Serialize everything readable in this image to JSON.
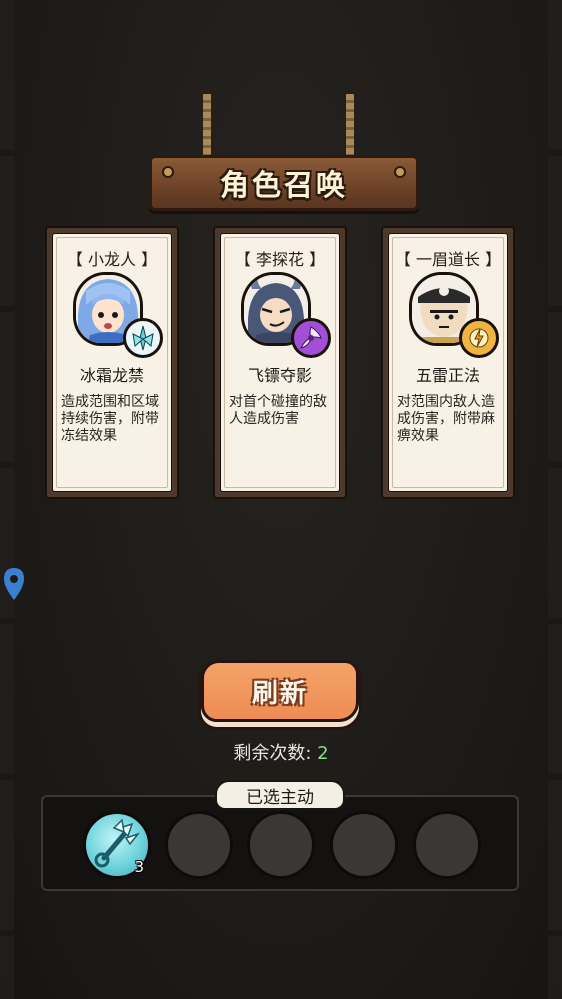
{
  "screen_title": "角色召唤",
  "cards": [
    {
      "character": "【 小龙人 】",
      "skill": "冰霜龙禁",
      "description": "造成范围和区域持续伤害，附带冻结效果",
      "portrait_icon": "blue-hair-hero-portrait",
      "badge_icon": "ice-crystal-icon",
      "badge_color": "#7fe3ea"
    },
    {
      "character": "【 李探花 】",
      "skill": "飞镖夺影",
      "description": "对首个碰撞的敌人造成伤害",
      "portrait_icon": "horned-helmet-hero-portrait",
      "badge_icon": "purple-shuriken-icon",
      "badge_color": "#a04fd6"
    },
    {
      "character": "【 一眉道长 】",
      "skill": "五雷正法",
      "description": "对范围内敌人造成伤害，附带麻痹效果",
      "portrait_icon": "taoist-priest-portrait",
      "badge_icon": "lightning-orb-icon",
      "badge_color": "#f2b440"
    }
  ],
  "refresh_button": "刷新",
  "remaining": {
    "label": "剩余次数:",
    "count": "2"
  },
  "selected_panel": {
    "title": "已选主动",
    "slots": [
      {
        "icon": "ice-trident-skill-icon",
        "level": "3"
      },
      {
        "icon": "empty-slot"
      },
      {
        "icon": "empty-slot"
      },
      {
        "icon": "empty-slot"
      },
      {
        "icon": "empty-slot"
      }
    ]
  },
  "colors": {
    "background": "#1e1c1a",
    "sign_wood": "#7a4a2e",
    "refresh_orange": "#f29a5c",
    "count_green": "#7fe08a",
    "card_paper": "#f7f1e6"
  }
}
